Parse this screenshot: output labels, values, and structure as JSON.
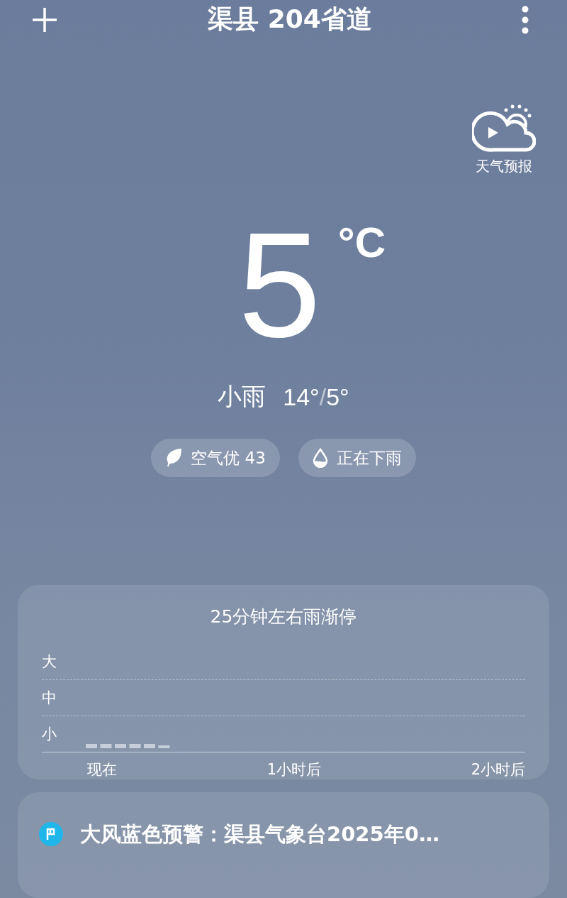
{
  "header": {
    "title": "渠县 204省道"
  },
  "forecast_video": {
    "label": "天气预报"
  },
  "current": {
    "temperature": "5",
    "unit": "°C",
    "condition": "小雨",
    "high": "14°",
    "separator": "/",
    "low": "5°"
  },
  "chips": [
    {
      "kind": "air",
      "label": "空气优 43"
    },
    {
      "kind": "rain",
      "label": "正在下雨"
    }
  ],
  "precipitation": {
    "title": "25分钟左右雨渐停",
    "levels": [
      "大",
      "中",
      "小"
    ],
    "time_labels": [
      "现在",
      "1小时后",
      "2小时后"
    ]
  },
  "alert": {
    "text": "大风蓝色预警：渠县气象台2025年0…"
  }
}
